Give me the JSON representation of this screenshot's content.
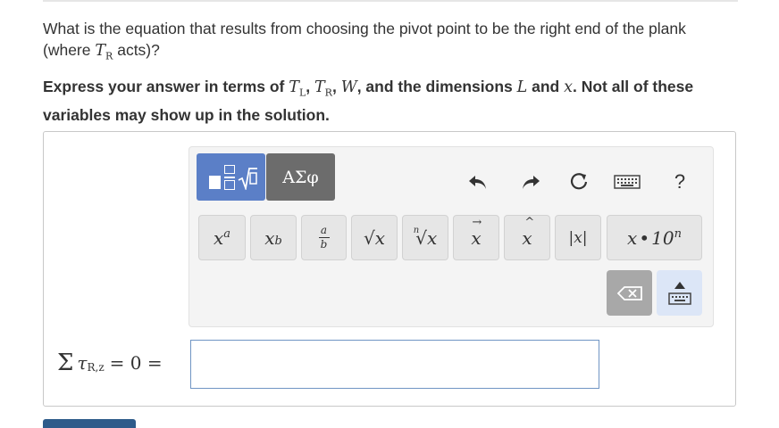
{
  "question": {
    "line1_prefix": "What is the equation that results from choosing the pivot point to be the right end of the plank",
    "line2_open": "(where ",
    "t_symbol": "T",
    "t_right_sub": "R",
    "line2_close": " acts)?"
  },
  "instruction": {
    "part1": "Express your answer in terms of ",
    "tl_sym": "T",
    "tl_sub": "L",
    "comma1": ", ",
    "tr_sym": "T",
    "tr_sub": "R",
    "comma2": ", ",
    "w_sym": "W",
    "part2": ", and the dimensions ",
    "l_sym": "L",
    "part3": " and ",
    "x_sym": "x",
    "part4": ". Not all of these variables may show up in the solution."
  },
  "toolbar": {
    "greek_label": "ΑΣφ",
    "help_label": "?",
    "buttons": {
      "superscript_base": "x",
      "superscript_exp": "a",
      "subscript_base": "x",
      "subscript_sub": "b",
      "frac_num": "a",
      "frac_den": "b",
      "sqrt": "√x",
      "nthroot_index": "n",
      "nthroot": "√x",
      "vector": "x",
      "vector_arrow": "→",
      "unit_vector": "x",
      "unit_vector_hat": "^",
      "abs": "|x|",
      "sci_x": "x",
      "sci_dot": "•",
      "sci_ten": "10",
      "sci_exp": "n"
    }
  },
  "equation": {
    "sigma": "Σ",
    "tau": "τ",
    "sub": "R,z",
    "rhs": " = 0 ="
  },
  "answer": {
    "value": "",
    "placeholder": ""
  },
  "colors": {
    "templates_tab": "#5b7fc7",
    "greek_tab": "#6c6c6c",
    "input_border": "#7095c4",
    "submit": "#2e5b8a"
  }
}
